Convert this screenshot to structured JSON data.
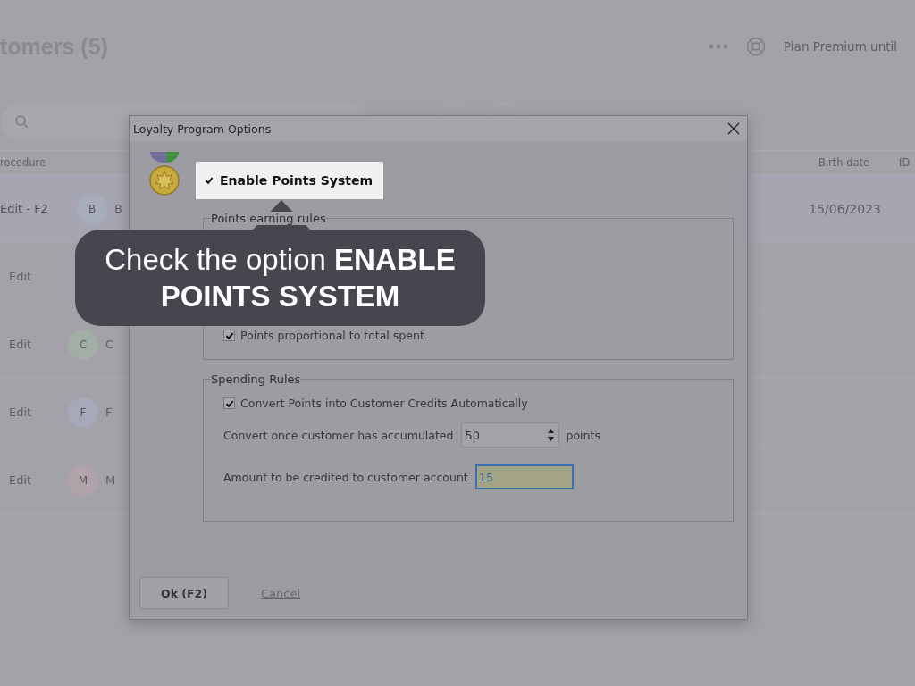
{
  "app": {
    "title": "tomers (5)",
    "plan": "Plan Premium until",
    "table": {
      "columns": [
        "rocedure",
        "Birth date",
        "ID"
      ],
      "rows": [
        {
          "action": "Edit - F2",
          "initial": "B",
          "name": "B",
          "color": "#a6acb9",
          "birth_date": "15/06/2023",
          "selected": true
        },
        {
          "action": "Edit",
          "selected": false
        },
        {
          "action": "Edit",
          "initial": "C",
          "name": "C",
          "color": "#a3aea6",
          "selected": false
        },
        {
          "action": "Edit",
          "initial": "F",
          "name": "F",
          "color": "#a6aab8",
          "selected": false
        },
        {
          "action": "Edit",
          "initial": "M",
          "name": "M",
          "color": "#b0a4aa",
          "selected": false
        }
      ]
    }
  },
  "dialog": {
    "title": "Loyalty Program Options",
    "enable": {
      "label": "Enable Points System",
      "checked": true
    },
    "earning_group": {
      "legend": "Points earning rules",
      "options": [
        {
          "label": "Points proportional to total spent.",
          "checked": true
        }
      ]
    },
    "spending_group": {
      "legend": "Spending Rules",
      "auto_convert": {
        "label": "Convert Points into Customer Credits Automatically",
        "checked": true
      },
      "threshold": {
        "label": "Convert once customer has accumulated",
        "value": "50",
        "unit": "points"
      },
      "credit": {
        "label": "Amount to be credited to customer account",
        "value": "15"
      }
    },
    "buttons": {
      "ok": "Ok (F2)",
      "cancel": "Cancel"
    }
  },
  "callout": {
    "text": "Check the option **ENABLE POINTS SYSTEM**"
  }
}
